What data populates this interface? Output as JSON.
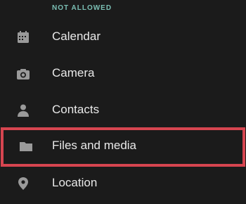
{
  "section": {
    "header": "NOT ALLOWED"
  },
  "permissions": [
    {
      "label": "Calendar",
      "icon": "calendar-icon"
    },
    {
      "label": "Camera",
      "icon": "camera-icon"
    },
    {
      "label": "Contacts",
      "icon": "person-icon"
    },
    {
      "label": "Files and media",
      "icon": "folder-icon",
      "highlighted": true
    },
    {
      "label": "Location",
      "icon": "location-pin-icon"
    }
  ],
  "colors": {
    "background": "#1b1b1b",
    "header_accent": "#7bbfb4",
    "text": "#e9e9e9",
    "icon": "#9a9a9a",
    "highlight_border": "#d64550"
  }
}
